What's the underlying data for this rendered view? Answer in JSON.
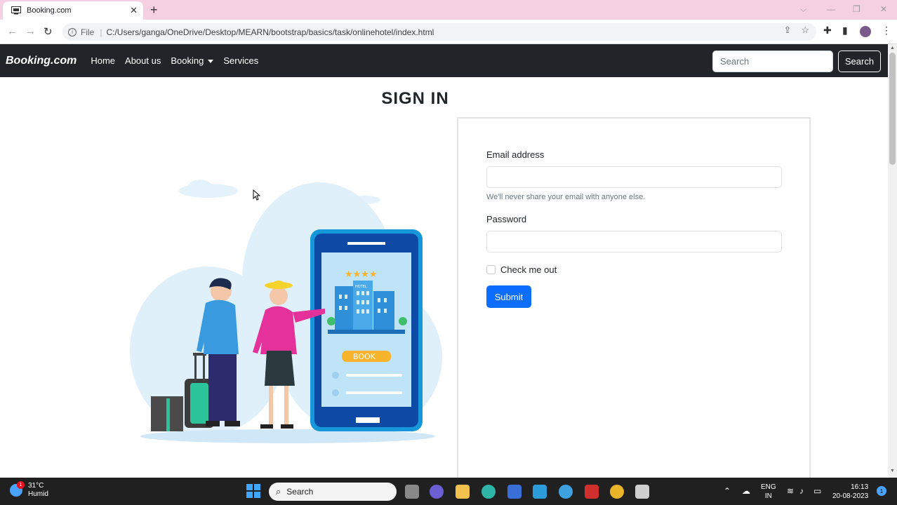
{
  "browser": {
    "tab_title": "Booking.com",
    "address": "C:/Users/ganga/OneDrive/Desktop/MEARN/bootstrap/basics/task/onlinehotel/index.html",
    "protocol_label": "File"
  },
  "navbar": {
    "brand": "Booking.com",
    "links": [
      "Home",
      "About us",
      "Booking",
      "Services"
    ],
    "search_placeholder": "Search",
    "search_button": "Search"
  },
  "page": {
    "heading": "SIGN IN"
  },
  "illustration": {
    "book_label": "BOOK",
    "hotel_label": "HOTEL"
  },
  "form": {
    "email_label": "Email address",
    "email_value": "",
    "email_help": "We'll never share your email with anyone else.",
    "password_label": "Password",
    "password_value": "",
    "checkbox_label": "Check me out",
    "submit_label": "Submit"
  },
  "taskbar": {
    "weather_temp": "31°C",
    "weather_desc": "Humid",
    "weather_badge": "1",
    "search_label": "Search",
    "lang_top": "ENG",
    "lang_bottom": "IN",
    "time": "16:13",
    "date": "20-08-2023",
    "notif_count": "1"
  }
}
